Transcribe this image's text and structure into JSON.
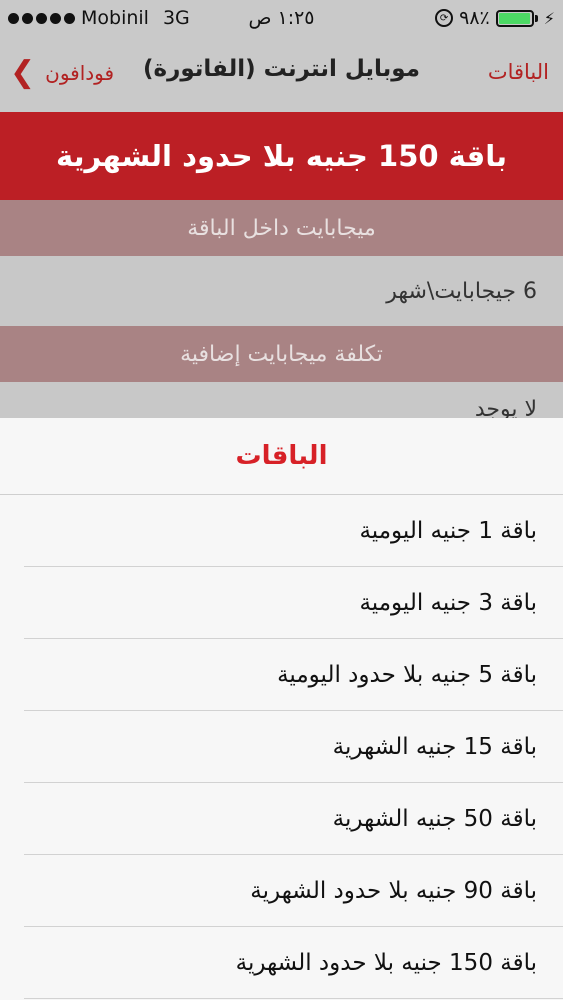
{
  "status_bar": {
    "carrier": "Mobinil",
    "network": "3G",
    "time": "١:٢٥ ص",
    "battery_percent": "٩٨٪",
    "battery_level": 0.98,
    "colors": {
      "battery": "#4cd964"
    }
  },
  "nav": {
    "title": "موبايل انترنت (الفاتورة)",
    "back_label": "فودافون",
    "right_label": "الباقات"
  },
  "content": {
    "banner_title": "باقة 150 جنيه بلا حدود الشهرية",
    "section_1_header": "ميجابايت داخل الباقة",
    "section_1_value": "6 جيجابايت\\شهر",
    "section_2_header": "تكلفة ميجابايت إضافية",
    "section_2_value": "لا يوجد"
  },
  "sheet": {
    "title": "الباقات",
    "items": [
      "باقة 1 جنيه اليومية",
      "باقة 3 جنيه اليومية",
      "باقة 5 جنيه بلا حدود اليومية",
      "باقة 15 جنيه الشهرية",
      "باقة 50 جنيه الشهرية",
      "باقة 90 جنيه بلا حدود الشهرية",
      "باقة 150 جنيه بلا حدود الشهرية"
    ]
  },
  "colors": {
    "brand_red": "#bc1f25",
    "accent_red": "#d72127"
  },
  "icons": [
    "signal-dots-icon",
    "orientation-lock-icon",
    "battery-icon",
    "charging-bolt-icon",
    "chevron-left-icon"
  ]
}
